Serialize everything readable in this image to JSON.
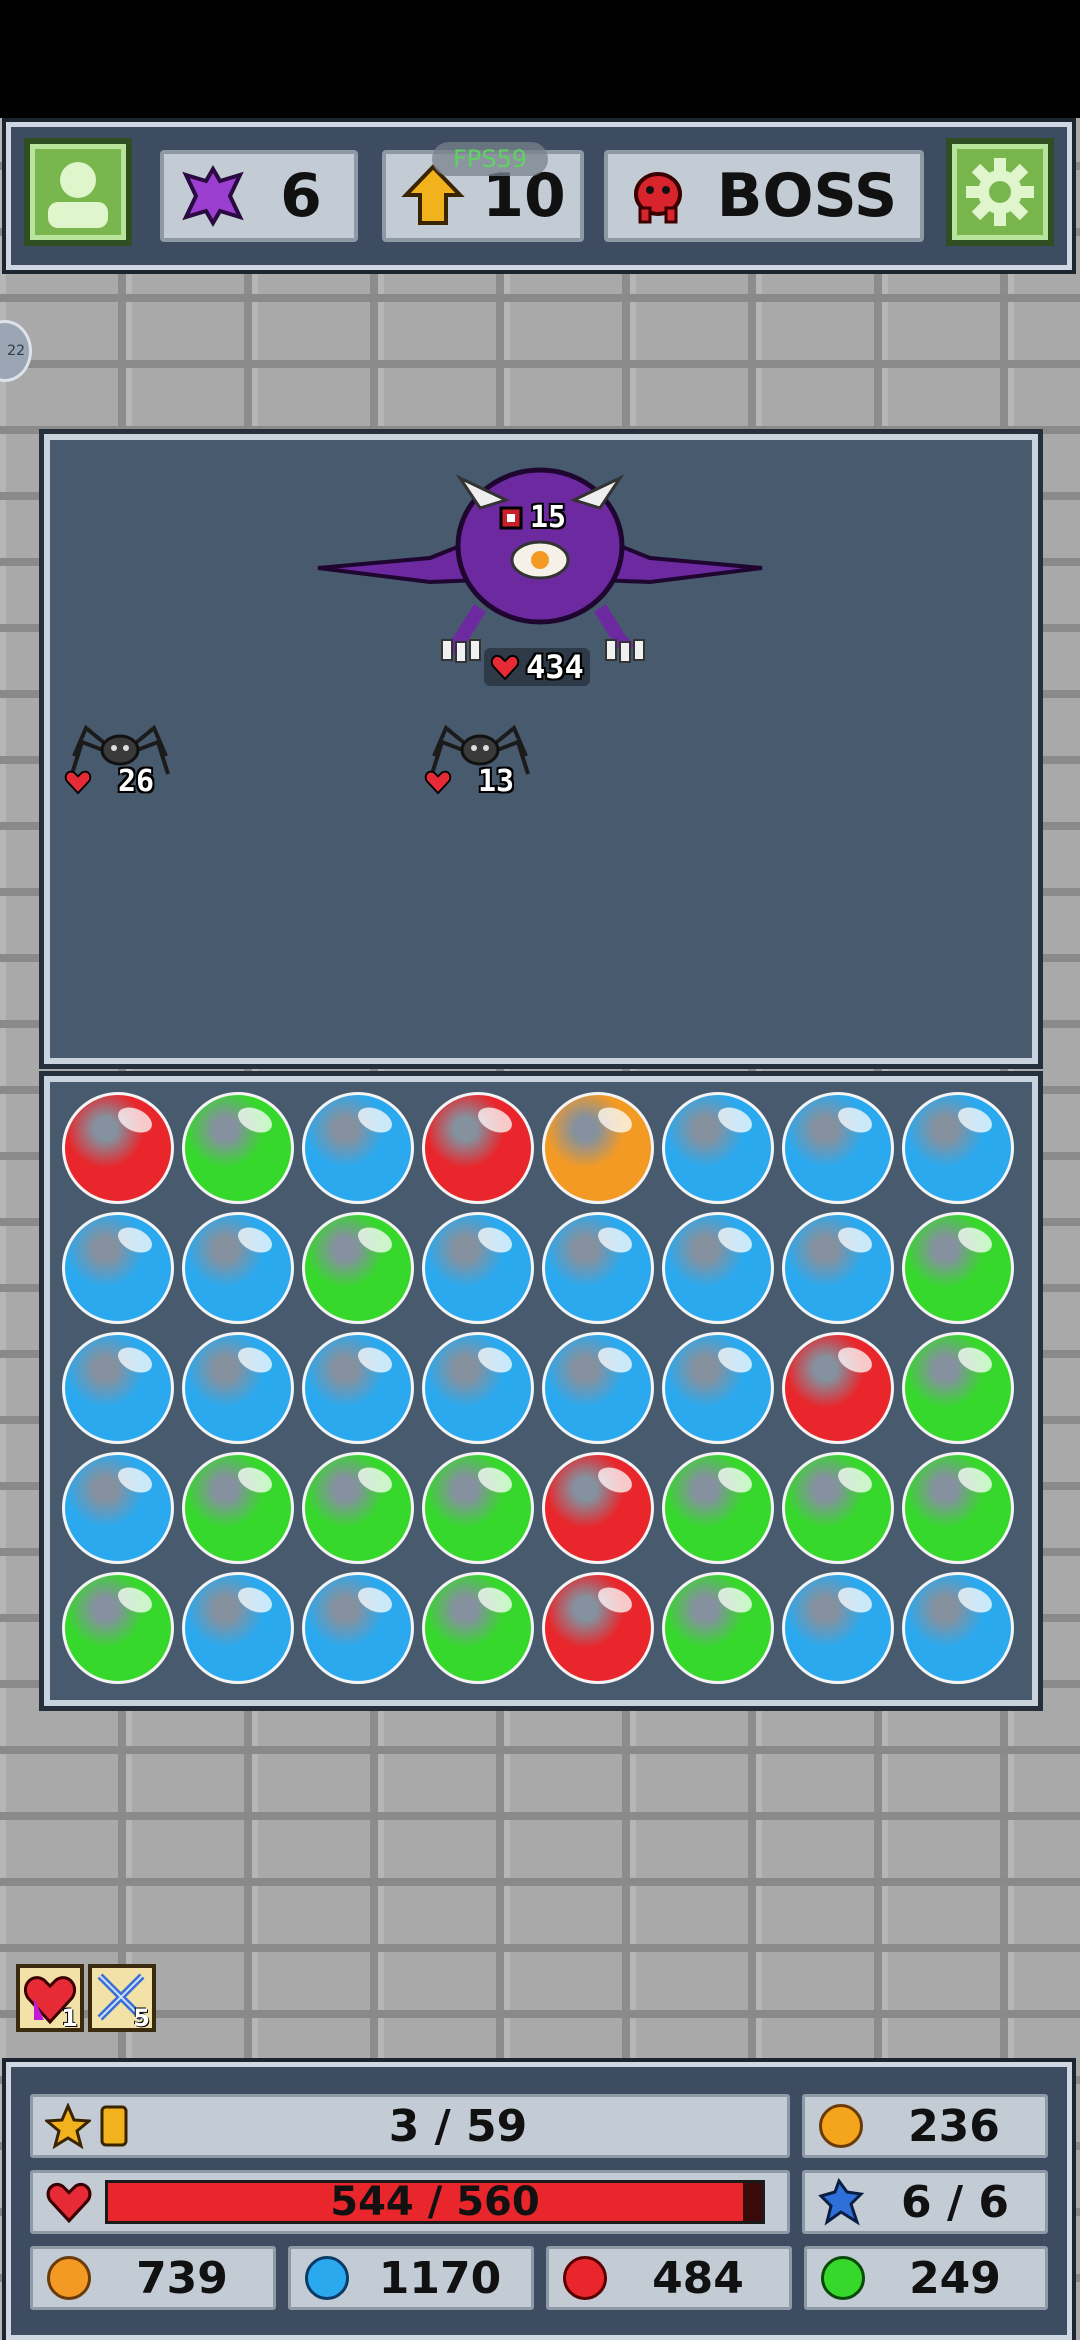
{
  "hud": {
    "fps_label": "FPS59",
    "shards": "6",
    "level": "10",
    "stage": "BOSS"
  },
  "side_tab_label": "22",
  "battle": {
    "boss": {
      "name_icon": "boss-purple-demon-icon",
      "attack": "15",
      "hp": "434"
    },
    "enemies": [
      {
        "icon": "spider-icon",
        "hp": "26"
      },
      {
        "icon": "spider-icon",
        "hp": "13"
      }
    ]
  },
  "orb_colors": {
    "R": "#e8262b",
    "G": "#36d82c",
    "B": "#2aa9ef",
    "O": "#f39a25"
  },
  "board": [
    [
      "R",
      "G",
      "B",
      "R",
      "O",
      "B",
      "B",
      "B"
    ],
    [
      "B",
      "B",
      "G",
      "B",
      "B",
      "B",
      "B",
      "G"
    ],
    [
      "B",
      "B",
      "B",
      "B",
      "B",
      "B",
      "R",
      "G"
    ],
    [
      "B",
      "G",
      "G",
      "G",
      "R",
      "G",
      "G",
      "G"
    ],
    [
      "G",
      "B",
      "B",
      "G",
      "R",
      "G",
      "B",
      "B"
    ]
  ],
  "items": [
    {
      "icon": "heart-potion-icon",
      "count": "1"
    },
    {
      "icon": "crossed-swords-icon",
      "count": "5"
    }
  ],
  "stats": {
    "exp": "3 / 59",
    "gold": "236",
    "hp_text": "544 / 560",
    "hp_fraction": 0.971,
    "moves": "6 / 6",
    "orange_count": "739",
    "blue_count": "1170",
    "red_count": "484",
    "green_count": "249"
  }
}
